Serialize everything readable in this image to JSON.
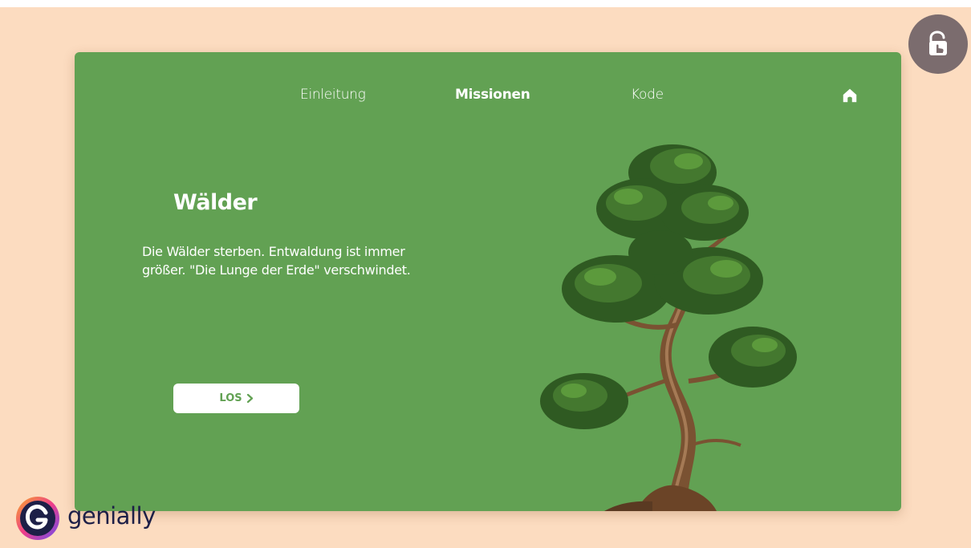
{
  "nav": {
    "items": [
      {
        "label": "Einleitung"
      },
      {
        "label": "Missionen",
        "active": true
      },
      {
        "label": "Kode"
      }
    ],
    "home_icon": "home-icon"
  },
  "main": {
    "title": "Wälder",
    "description": "Die Wälder sterben. Entwaldung ist immer größer. \"Die Lunge der Erde\" verschwindet.",
    "button_label": "LOS",
    "button_icon": "chevron-right-icon",
    "image": "bonsai-tree"
  },
  "overlay": {
    "interaction_icon": "touch-unlock-icon"
  },
  "brand": {
    "name": "genially",
    "logo_icon": "genially-logo-icon"
  },
  "colors": {
    "page_background": "#fcdcc0",
    "slide_background": "#62a153",
    "text": "#ffffff",
    "badge": "#7b6c6e",
    "brand_text": "#1d1f47"
  }
}
